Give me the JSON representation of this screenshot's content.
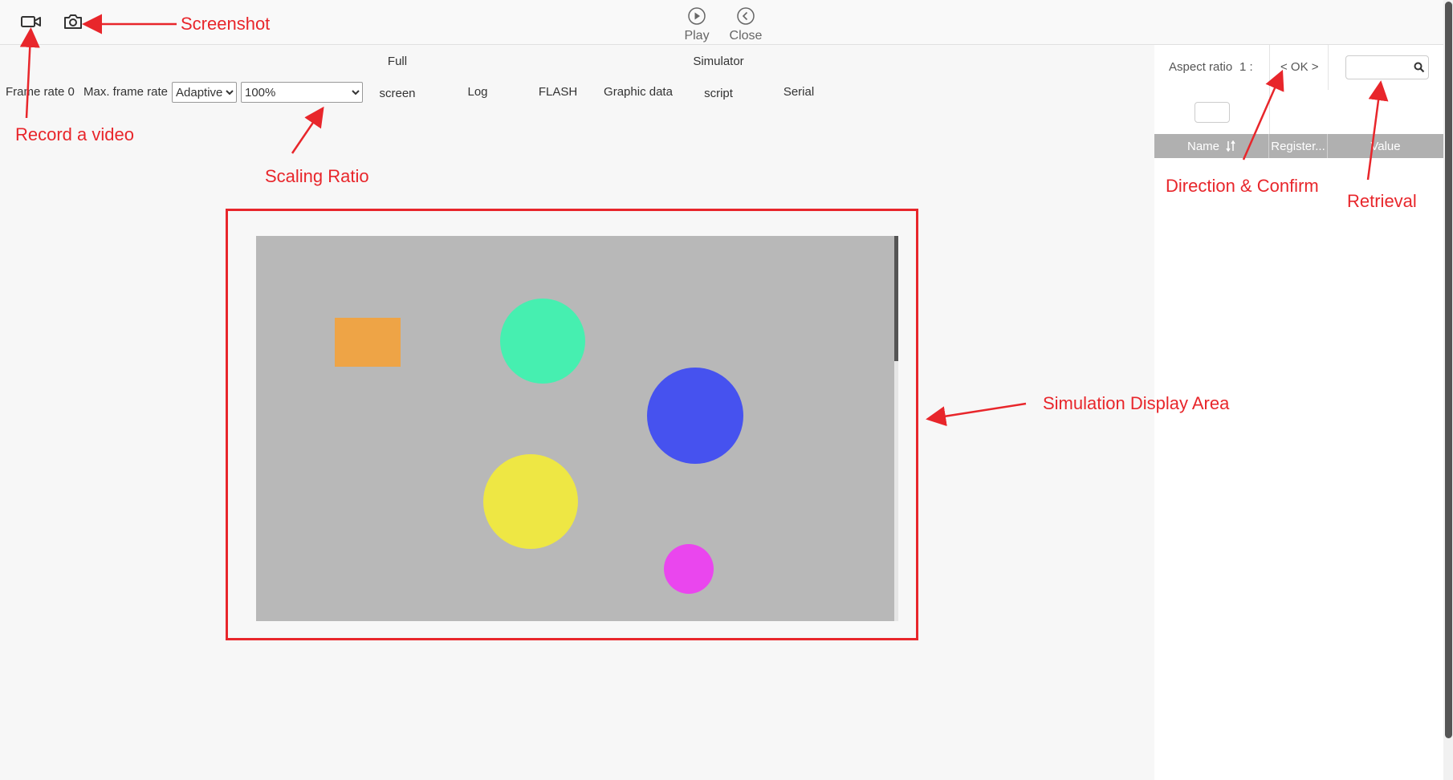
{
  "topbar": {
    "record_icon": "video-camera-icon",
    "screenshot_icon": "camera-icon",
    "play_label": "Play",
    "close_label": "Close"
  },
  "toolbar": {
    "frame_rate_label": "Frame rate 0",
    "max_frame_rate_label": "Max. frame rate",
    "max_frame_rate_value": "Adaptive",
    "scaling_value": "100%",
    "full_screen_top": "Full",
    "full_screen_bottom": "screen",
    "log_label": "Log",
    "flash_label": "FLASH",
    "graphic_data_label": "Graphic data",
    "simulator_script_top": "Simulator",
    "simulator_script_bottom": "script",
    "serial_label": "Serial"
  },
  "right_panel": {
    "aspect_ratio_label": "Aspect ratio",
    "aspect_ratio_value": "1 :",
    "direction_confirm": "< OK >",
    "search_placeholder": "",
    "table_columns": [
      "Name",
      "Register...",
      "Value"
    ]
  },
  "annotations": {
    "screenshot": "Screenshot",
    "record_video": "Record a video",
    "scaling_ratio": "Scaling Ratio",
    "direction_confirm": "Direction & Confirm",
    "retrieval": "Retrieval",
    "simulation_area": "Simulation Display Area"
  },
  "colors": {
    "annotation": "#e8262b",
    "canvas_bg": "#b8b8b8",
    "orange_rect": "#eea446",
    "green_circle": "#46efb0",
    "blue_circle": "#4652ef",
    "yellow_circle": "#eee744",
    "magenta_circle": "#ea46ee"
  }
}
